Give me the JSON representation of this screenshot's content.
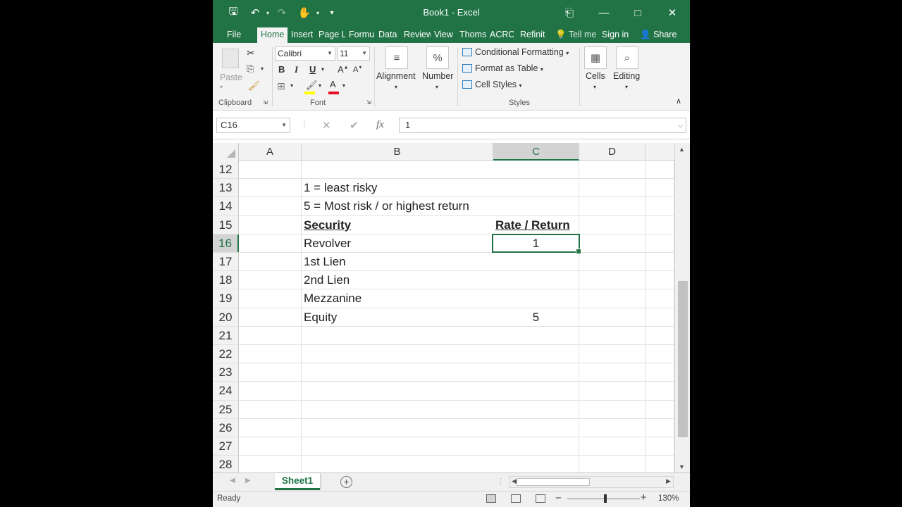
{
  "window": {
    "title": "Book1 - Excel"
  },
  "menu": {
    "tabs": [
      "File",
      "Home",
      "Insert",
      "Page L",
      "Formu",
      "Data",
      "Review",
      "View",
      "Thoms",
      "ACRO",
      "Refinit"
    ],
    "tell_me": "Tell me",
    "sign_in": "Sign in",
    "share": "Share"
  },
  "ribbon": {
    "clipboard": {
      "paste": "Paste",
      "label": "Clipboard"
    },
    "font": {
      "name": "Calibri",
      "size": "11",
      "bold": "B",
      "italic": "I",
      "underline": "U",
      "grow": "A",
      "shrink": "A",
      "color": "A",
      "label": "Font"
    },
    "alignment": "Alignment",
    "number": {
      "label": "Number",
      "symbol": "%"
    },
    "styles": {
      "conditional": "Conditional Formatting",
      "format_table": "Format as Table",
      "cell_styles": "Cell Styles",
      "label": "Styles"
    },
    "cells": "Cells",
    "editing": "Editing"
  },
  "formula_bar": {
    "name_box": "C16",
    "fx": "fx",
    "value": "1"
  },
  "columns": [
    "A",
    "B",
    "C",
    "D"
  ],
  "rows": [
    {
      "num": "12",
      "B": "",
      "C": ""
    },
    {
      "num": "13",
      "B": "1 = least risky",
      "C": ""
    },
    {
      "num": "14",
      "B": "5 = Most risk / or highest return",
      "C": ""
    },
    {
      "num": "15",
      "B": "Security",
      "C": "Rate / Return"
    },
    {
      "num": "16",
      "B": "Revolver",
      "C": "1"
    },
    {
      "num": "17",
      "B": "1st Lien",
      "C": ""
    },
    {
      "num": "18",
      "B": "2nd Lien",
      "C": ""
    },
    {
      "num": "19",
      "B": "Mezzanine",
      "C": ""
    },
    {
      "num": "20",
      "B": "Equity",
      "C": "5"
    },
    {
      "num": "21",
      "B": "",
      "C": ""
    },
    {
      "num": "22",
      "B": "",
      "C": ""
    },
    {
      "num": "23",
      "B": "",
      "C": ""
    },
    {
      "num": "24",
      "B": "",
      "C": ""
    },
    {
      "num": "25",
      "B": "",
      "C": ""
    },
    {
      "num": "26",
      "B": "",
      "C": ""
    },
    {
      "num": "27",
      "B": "",
      "C": ""
    },
    {
      "num": "28",
      "B": "",
      "C": ""
    }
  ],
  "active_cell": {
    "row": "16",
    "col": "C"
  },
  "sheets": [
    "Sheet1"
  ],
  "status": {
    "ready": "Ready",
    "zoom": "130%"
  },
  "colors": {
    "excel_green": "#217346"
  }
}
